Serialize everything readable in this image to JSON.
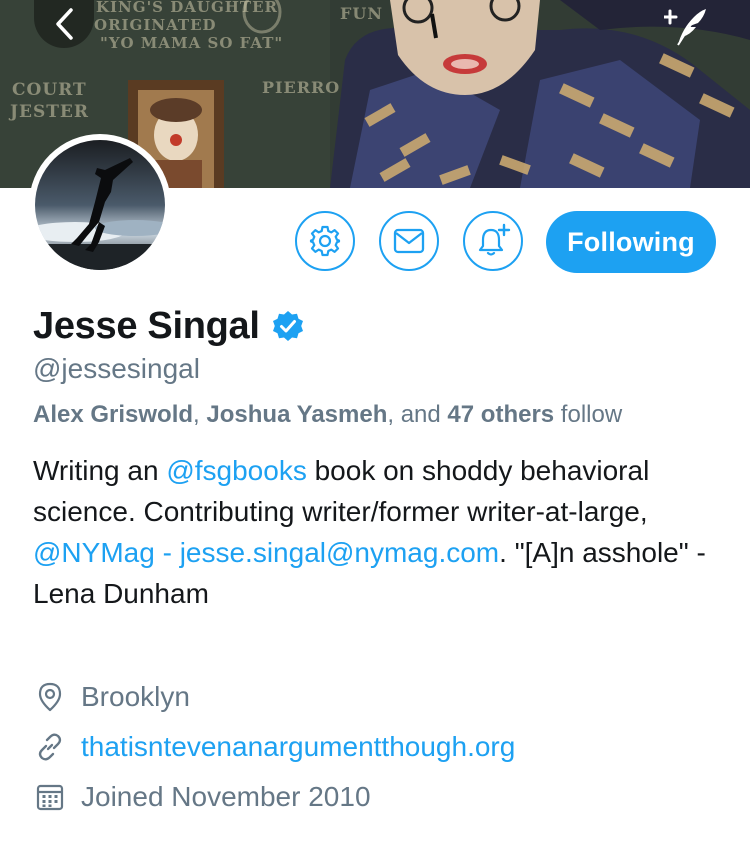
{
  "header": {
    "back_icon": "chevron-left-icon",
    "compose_icon": "compose-feather-icon",
    "banner_chalk": {
      "line1": "KING'S DAUGHTER",
      "line2": "ORIGINATED",
      "line3": "\"YO MAMA SO FAT\"",
      "court": "COURT",
      "jester": "JESTER",
      "fun": "FUN",
      "pierrot": "PIERRO"
    }
  },
  "actions": {
    "settings_icon": "gear-icon",
    "message_icon": "envelope-icon",
    "notify_icon": "bell-plus-icon",
    "follow_label": "Following"
  },
  "profile": {
    "name": "Jesse Singal",
    "verified_icon": "verified-badge-icon",
    "handle": "@jessesingal",
    "followed_by": {
      "name1": "Alex Griswold",
      "sep": ", ",
      "name2": "Joshua Yasmeh",
      "and": ", and ",
      "count": "47 others",
      "suffix": " follow"
    },
    "bio": {
      "t1": "Writing an ",
      "mention1": "@fsgbooks",
      "t2": " book on shoddy behavioral science. Contributing writer/former writer-at-large, ",
      "mention2": "@NYMag",
      "t3": " - ",
      "email": "jesse.singal@nymag.com",
      "t4": ". \"[A]n asshole\" - Lena Dunham"
    },
    "location": "Brooklyn",
    "location_icon": "location-pin-icon",
    "website": "thatisntevenanargumentthough.org",
    "website_icon": "link-icon",
    "joined": "Joined November 2010",
    "joined_icon": "calendar-icon"
  },
  "colors": {
    "accent": "#1da1f2",
    "text": "#14171a",
    "secondary": "#657786"
  }
}
